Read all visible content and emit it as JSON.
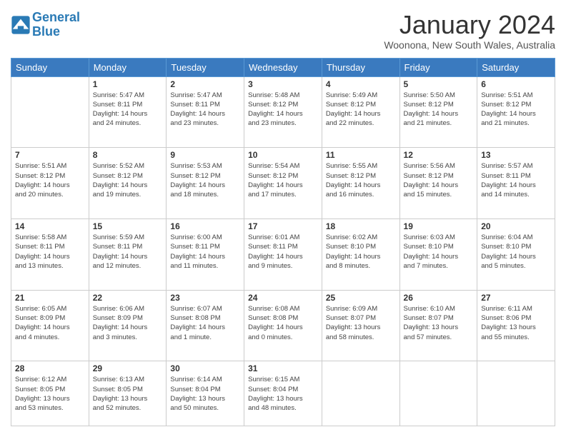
{
  "header": {
    "logo_line1": "General",
    "logo_line2": "Blue",
    "month": "January 2024",
    "location": "Woonona, New South Wales, Australia"
  },
  "days_header": [
    "Sunday",
    "Monday",
    "Tuesday",
    "Wednesday",
    "Thursday",
    "Friday",
    "Saturday"
  ],
  "weeks": [
    [
      {
        "num": "",
        "info": ""
      },
      {
        "num": "1",
        "info": "Sunrise: 5:47 AM\nSunset: 8:11 PM\nDaylight: 14 hours\nand 24 minutes."
      },
      {
        "num": "2",
        "info": "Sunrise: 5:47 AM\nSunset: 8:11 PM\nDaylight: 14 hours\nand 23 minutes."
      },
      {
        "num": "3",
        "info": "Sunrise: 5:48 AM\nSunset: 8:12 PM\nDaylight: 14 hours\nand 23 minutes."
      },
      {
        "num": "4",
        "info": "Sunrise: 5:49 AM\nSunset: 8:12 PM\nDaylight: 14 hours\nand 22 minutes."
      },
      {
        "num": "5",
        "info": "Sunrise: 5:50 AM\nSunset: 8:12 PM\nDaylight: 14 hours\nand 21 minutes."
      },
      {
        "num": "6",
        "info": "Sunrise: 5:51 AM\nSunset: 8:12 PM\nDaylight: 14 hours\nand 21 minutes."
      }
    ],
    [
      {
        "num": "7",
        "info": "Sunrise: 5:51 AM\nSunset: 8:12 PM\nDaylight: 14 hours\nand 20 minutes."
      },
      {
        "num": "8",
        "info": "Sunrise: 5:52 AM\nSunset: 8:12 PM\nDaylight: 14 hours\nand 19 minutes."
      },
      {
        "num": "9",
        "info": "Sunrise: 5:53 AM\nSunset: 8:12 PM\nDaylight: 14 hours\nand 18 minutes."
      },
      {
        "num": "10",
        "info": "Sunrise: 5:54 AM\nSunset: 8:12 PM\nDaylight: 14 hours\nand 17 minutes."
      },
      {
        "num": "11",
        "info": "Sunrise: 5:55 AM\nSunset: 8:12 PM\nDaylight: 14 hours\nand 16 minutes."
      },
      {
        "num": "12",
        "info": "Sunrise: 5:56 AM\nSunset: 8:12 PM\nDaylight: 14 hours\nand 15 minutes."
      },
      {
        "num": "13",
        "info": "Sunrise: 5:57 AM\nSunset: 8:11 PM\nDaylight: 14 hours\nand 14 minutes."
      }
    ],
    [
      {
        "num": "14",
        "info": "Sunrise: 5:58 AM\nSunset: 8:11 PM\nDaylight: 14 hours\nand 13 minutes."
      },
      {
        "num": "15",
        "info": "Sunrise: 5:59 AM\nSunset: 8:11 PM\nDaylight: 14 hours\nand 12 minutes."
      },
      {
        "num": "16",
        "info": "Sunrise: 6:00 AM\nSunset: 8:11 PM\nDaylight: 14 hours\nand 11 minutes."
      },
      {
        "num": "17",
        "info": "Sunrise: 6:01 AM\nSunset: 8:11 PM\nDaylight: 14 hours\nand 9 minutes."
      },
      {
        "num": "18",
        "info": "Sunrise: 6:02 AM\nSunset: 8:10 PM\nDaylight: 14 hours\nand 8 minutes."
      },
      {
        "num": "19",
        "info": "Sunrise: 6:03 AM\nSunset: 8:10 PM\nDaylight: 14 hours\nand 7 minutes."
      },
      {
        "num": "20",
        "info": "Sunrise: 6:04 AM\nSunset: 8:10 PM\nDaylight: 14 hours\nand 5 minutes."
      }
    ],
    [
      {
        "num": "21",
        "info": "Sunrise: 6:05 AM\nSunset: 8:09 PM\nDaylight: 14 hours\nand 4 minutes."
      },
      {
        "num": "22",
        "info": "Sunrise: 6:06 AM\nSunset: 8:09 PM\nDaylight: 14 hours\nand 3 minutes."
      },
      {
        "num": "23",
        "info": "Sunrise: 6:07 AM\nSunset: 8:08 PM\nDaylight: 14 hours\nand 1 minute."
      },
      {
        "num": "24",
        "info": "Sunrise: 6:08 AM\nSunset: 8:08 PM\nDaylight: 14 hours\nand 0 minutes."
      },
      {
        "num": "25",
        "info": "Sunrise: 6:09 AM\nSunset: 8:07 PM\nDaylight: 13 hours\nand 58 minutes."
      },
      {
        "num": "26",
        "info": "Sunrise: 6:10 AM\nSunset: 8:07 PM\nDaylight: 13 hours\nand 57 minutes."
      },
      {
        "num": "27",
        "info": "Sunrise: 6:11 AM\nSunset: 8:06 PM\nDaylight: 13 hours\nand 55 minutes."
      }
    ],
    [
      {
        "num": "28",
        "info": "Sunrise: 6:12 AM\nSunset: 8:05 PM\nDaylight: 13 hours\nand 53 minutes."
      },
      {
        "num": "29",
        "info": "Sunrise: 6:13 AM\nSunset: 8:05 PM\nDaylight: 13 hours\nand 52 minutes."
      },
      {
        "num": "30",
        "info": "Sunrise: 6:14 AM\nSunset: 8:04 PM\nDaylight: 13 hours\nand 50 minutes."
      },
      {
        "num": "31",
        "info": "Sunrise: 6:15 AM\nSunset: 8:04 PM\nDaylight: 13 hours\nand 48 minutes."
      },
      {
        "num": "",
        "info": ""
      },
      {
        "num": "",
        "info": ""
      },
      {
        "num": "",
        "info": ""
      }
    ]
  ]
}
